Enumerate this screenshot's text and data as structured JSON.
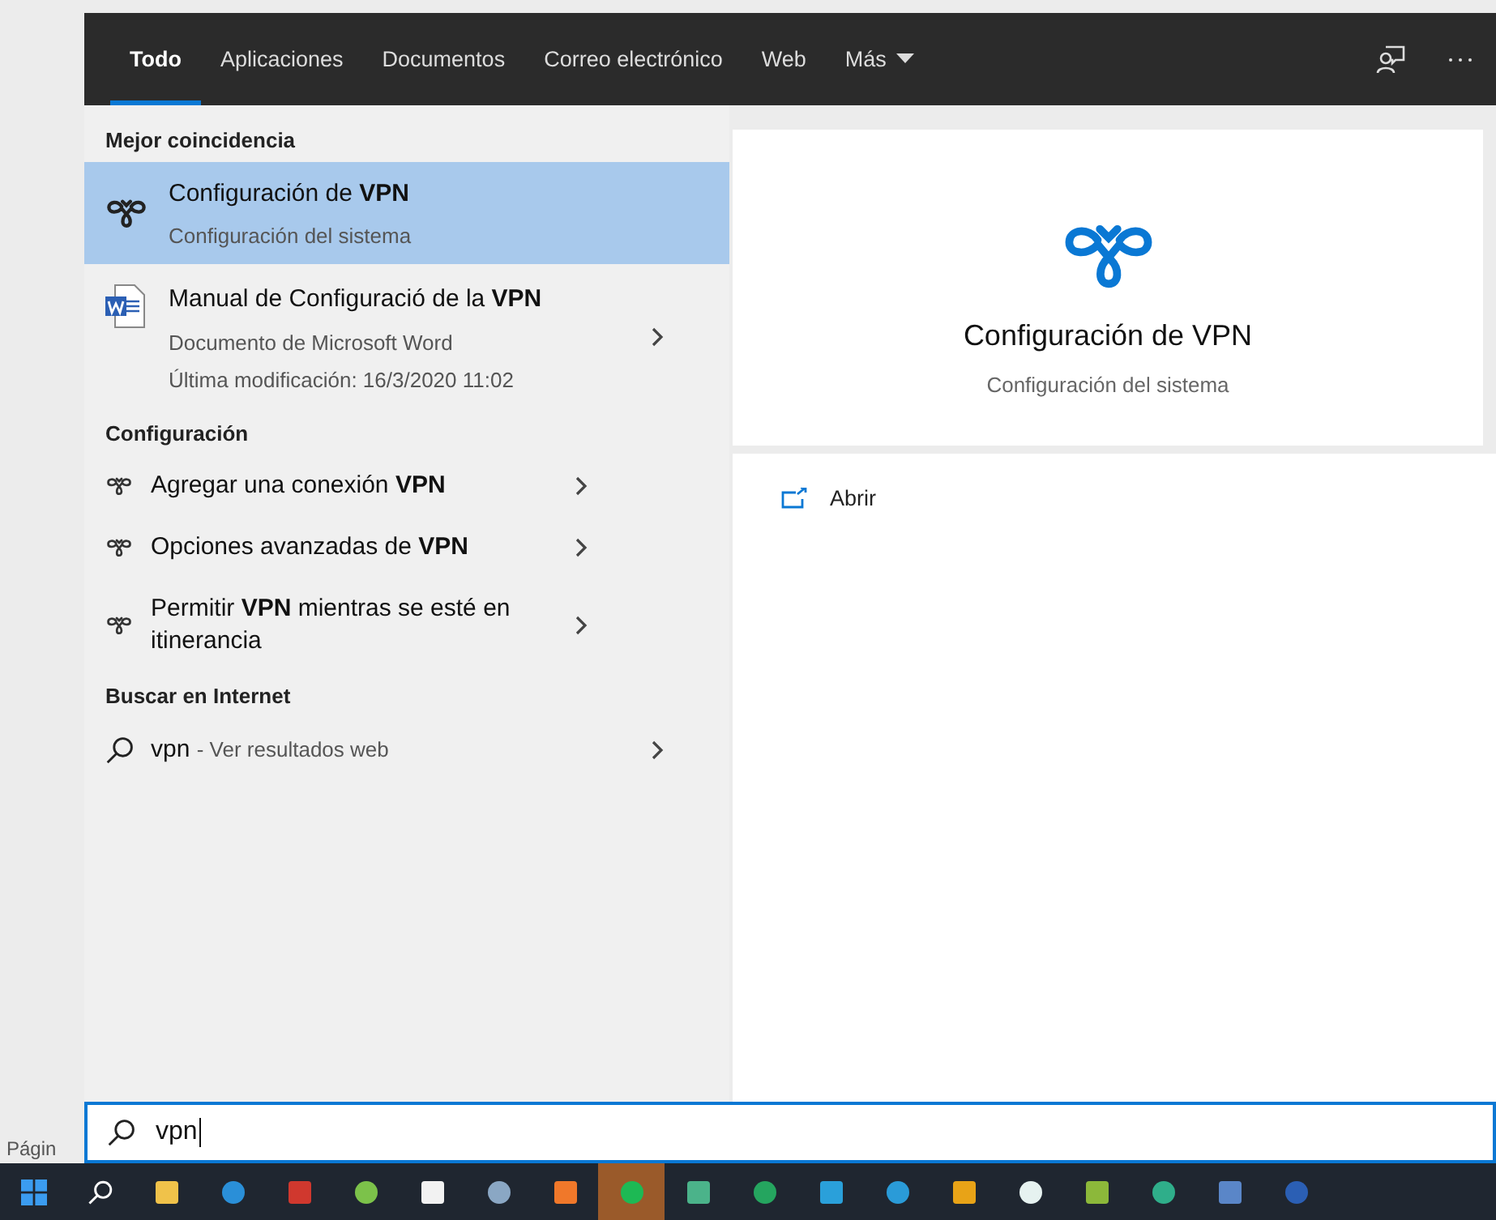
{
  "background_text": "Págin",
  "tabs": [
    {
      "label": "Todo",
      "selected": true
    },
    {
      "label": "Aplicaciones",
      "selected": false
    },
    {
      "label": "Documentos",
      "selected": false
    },
    {
      "label": "Correo electrónico",
      "selected": false
    },
    {
      "label": "Web",
      "selected": false
    },
    {
      "label": "Más",
      "selected": false,
      "dropdown": true
    }
  ],
  "sections": [
    {
      "heading": "Mejor coincidencia",
      "items": [
        {
          "kind": "best",
          "title": "Configuración de **VPN**",
          "subtitle": "Configuración del sistema",
          "selected": true
        },
        {
          "kind": "document",
          "title": "Manual de Configuració de la **VPN**",
          "subtitle": "Documento de Microsoft Word",
          "detail": "Última modificación: 16/3/2020 11:02",
          "selected": false
        }
      ]
    },
    {
      "heading": "Configuración",
      "items": [
        {
          "kind": "setting",
          "title": "Agregar una conexión **VPN**",
          "selected": false
        },
        {
          "kind": "setting",
          "title": "Opciones avanzadas de **VPN**",
          "selected": false
        },
        {
          "kind": "setting",
          "title": "Permitir **VPN** mientras se esté en itinerancia",
          "selected": false
        }
      ]
    },
    {
      "heading": "Buscar en Internet",
      "items": [
        {
          "kind": "web",
          "title": "vpn",
          "subtitle": "- Ver resultados web",
          "selected": false
        }
      ]
    }
  ],
  "preview": {
    "title": "Configuración de VPN",
    "subtitle": "Configuración del sistema",
    "actions": [
      "Abrir"
    ]
  },
  "search": {
    "value": "vpn"
  },
  "taskbar": [
    {
      "color": "#f0c24a",
      "selected": false
    },
    {
      "color": "#2a8fd8",
      "selected": false
    },
    {
      "color": "#d0382e",
      "selected": false
    },
    {
      "color": "#7cc24a",
      "selected": false
    },
    {
      "color": "#f2f2f2",
      "selected": false
    },
    {
      "color": "#8aa7c4",
      "selected": false
    },
    {
      "color": "#f0782a",
      "selected": false
    },
    {
      "color": "#1db954",
      "selected": true
    },
    {
      "color": "#4bb38a",
      "selected": false
    },
    {
      "color": "#25a55f",
      "selected": false
    },
    {
      "color": "#2aa0da",
      "selected": false
    },
    {
      "color": "#2a9bd8",
      "selected": false
    },
    {
      "color": "#e8a317",
      "selected": false
    },
    {
      "color": "#e6f2f0",
      "selected": false
    },
    {
      "color": "#8cb83a",
      "selected": false
    },
    {
      "color": "#2fae8a",
      "selected": false
    },
    {
      "color": "#5a86c8",
      "selected": false
    },
    {
      "color": "#2b5fb4",
      "selected": false
    }
  ]
}
